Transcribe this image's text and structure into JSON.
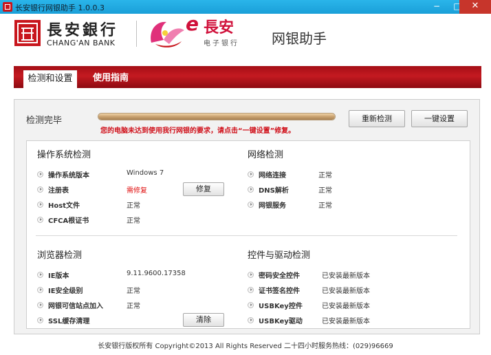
{
  "window": {
    "title": "长安银行网银助手 1.0.0.3",
    "minimize_glyph": "−",
    "maximize_glyph": "□",
    "close_glyph": "✕"
  },
  "header": {
    "bank_name": "長安銀行",
    "bank_name_en": "CHANG'AN BANK",
    "ebrand_e": "e",
    "ebrand_name": "長安",
    "ebrand_sub": "电子银行",
    "app_name": "网银助手"
  },
  "tabs": [
    {
      "label": "检测和设置",
      "active": true
    },
    {
      "label": "使用指南",
      "active": false
    }
  ],
  "status": {
    "label": "检测完毕",
    "progress": 1.0,
    "warning": "您的电脑未达到使用我行网银的要求，请点击“一键设置”修复。"
  },
  "buttons": {
    "recheck": "重新检测",
    "one_click_setup": "一键设置",
    "repair": "修复",
    "clear": "清除"
  },
  "sections": {
    "os": {
      "title": "操作系统检测",
      "rows": [
        {
          "label": "操作系统版本",
          "value": "Windows 7"
        },
        {
          "label": "注册表",
          "value": "需修复"
        },
        {
          "label": "Host文件",
          "value": "正常"
        },
        {
          "label": "CFCA根证书",
          "value": "正常"
        }
      ]
    },
    "network": {
      "title": "网络检测",
      "rows": [
        {
          "label": "网络连接",
          "value": "正常"
        },
        {
          "label": "DNS解析",
          "value": "正常"
        },
        {
          "label": "网银服务",
          "value": "正常"
        }
      ]
    },
    "browser": {
      "title": "浏览器检测",
      "rows": [
        {
          "label": "IE版本",
          "value": "9.11.9600.17358"
        },
        {
          "label": "IE安全级别",
          "value": "正常"
        },
        {
          "label": "网银可信站点加入",
          "value": "正常"
        },
        {
          "label": "SSL缓存清理",
          "value": ""
        }
      ]
    },
    "controls": {
      "title": "控件与驱动检测",
      "rows": [
        {
          "label": "密码安全控件",
          "value": "已安装最新版本"
        },
        {
          "label": "证书签名控件",
          "value": "已安装最新版本"
        },
        {
          "label": "USBKey控件",
          "value": "已安装最新版本"
        },
        {
          "label": "USBKey驱动",
          "value": "已安装最新版本"
        }
      ]
    }
  },
  "footer": {
    "text": "长安银行版权所有 Copyright©2013 All Rights Reserved 二十四小时服务热线：(029)96669"
  },
  "colors": {
    "brand_red": "#c41a21",
    "warning_red": "#d0101a",
    "titlebar_blue": "#1a9fd8"
  }
}
